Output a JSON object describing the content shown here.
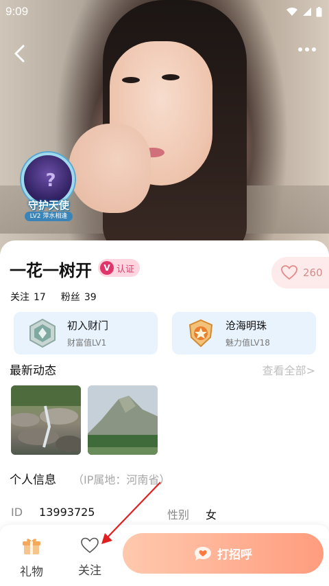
{
  "status_bar": {
    "time": "9:09"
  },
  "guard_badge": {
    "title": "守护天使",
    "level": "LV2 萍水相逢"
  },
  "profile": {
    "name": "一花一树开",
    "verify_label": "认证",
    "verify_letter": "V",
    "likes": "260",
    "following_label": "关注",
    "following_count": "17",
    "fans_label": "粉丝",
    "fans_count": "39"
  },
  "levels": [
    {
      "title": "初入财门",
      "subtitle": "财富值LV1",
      "icon": "wealth-badge-icon",
      "color": "#7fa8a0"
    },
    {
      "title": "沧海明珠",
      "subtitle": "魅力值LV18",
      "icon": "charm-badge-icon",
      "color": "#e8a24a"
    }
  ],
  "moments": {
    "title": "最新动态",
    "view_all": "查看全部>"
  },
  "info": {
    "title": "个人信息",
    "ip_location": "（IP属地：河南省）",
    "id_label": "ID",
    "id_value": "13993725",
    "gender_label": "性别",
    "gender_value": "女"
  },
  "bottom_bar": {
    "gift_label": "礼物",
    "follow_label": "关注",
    "greet_label": "打招呼"
  },
  "colors": {
    "accent": "#ff9c7e",
    "verify": "#e0356a",
    "annotation_arrow": "#e02020"
  }
}
